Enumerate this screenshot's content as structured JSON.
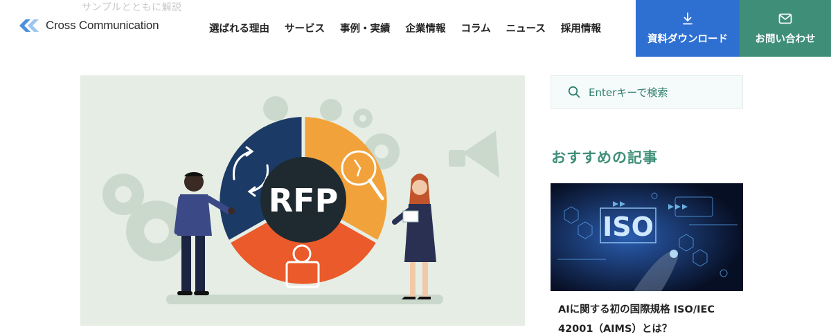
{
  "header": {
    "ghost_text": "サンプルとともに解説",
    "logo_text": "Cross Communication",
    "nav": [
      "選ばれる理由",
      "サービス",
      "事例・実績",
      "企業情報",
      "コラム",
      "ニュース",
      "採用情報"
    ],
    "download_label": "資料ダウンロード",
    "contact_label": "お問い合わせ"
  },
  "hero": {
    "center_label": "RFP"
  },
  "sidebar": {
    "search_placeholder": "Enterキーで検索",
    "recommended_title": "おすすめの記事",
    "article": {
      "thumb_text": "ISO",
      "title": "AIに関する初の国際規格 ISO/IEC 42001（AIMS）とは？"
    }
  },
  "colors": {
    "download_bg": "#2e6fd2",
    "contact_bg": "#3f8f78",
    "accent_green": "#3f8f78",
    "hero_bg": "#e6ede4"
  }
}
